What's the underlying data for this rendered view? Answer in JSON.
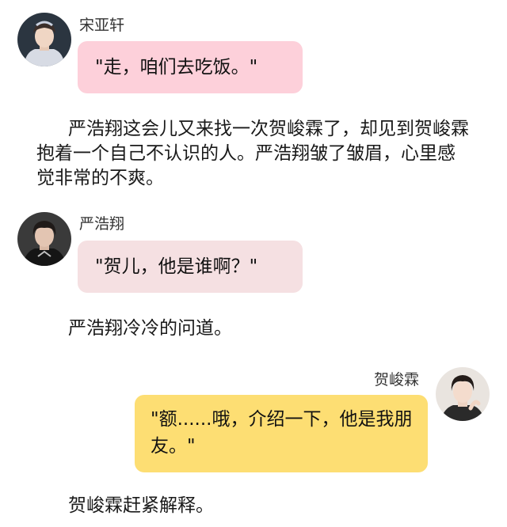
{
  "messages": [
    {
      "sender": "宋亚轩",
      "text": "\"走，咱们去吃饭。\"",
      "bubble_color": "#fdd0da",
      "side": "left",
      "avatar": "avatar-icon"
    },
    {
      "sender": "严浩翔",
      "text": "\"贺儿，他是谁啊？\"",
      "bubble_color": "#f5e0e2",
      "side": "left",
      "avatar": "avatar-icon"
    },
    {
      "sender": "贺峻霖",
      "text": "\"额......哦，介绍一下，他是我朋友。\"",
      "bubble_color": "#fdde73",
      "side": "right",
      "avatar": "avatar-icon"
    }
  ],
  "narrations": [
    "严浩翔这会儿又来找一次贺峻霖了，却见到贺峻霖抱着一个自己不认识的人。严浩翔皱了皱眉，心里感觉非常的不爽。",
    "严浩翔冷冷的问道。",
    "贺峻霖赶紧解释。"
  ]
}
